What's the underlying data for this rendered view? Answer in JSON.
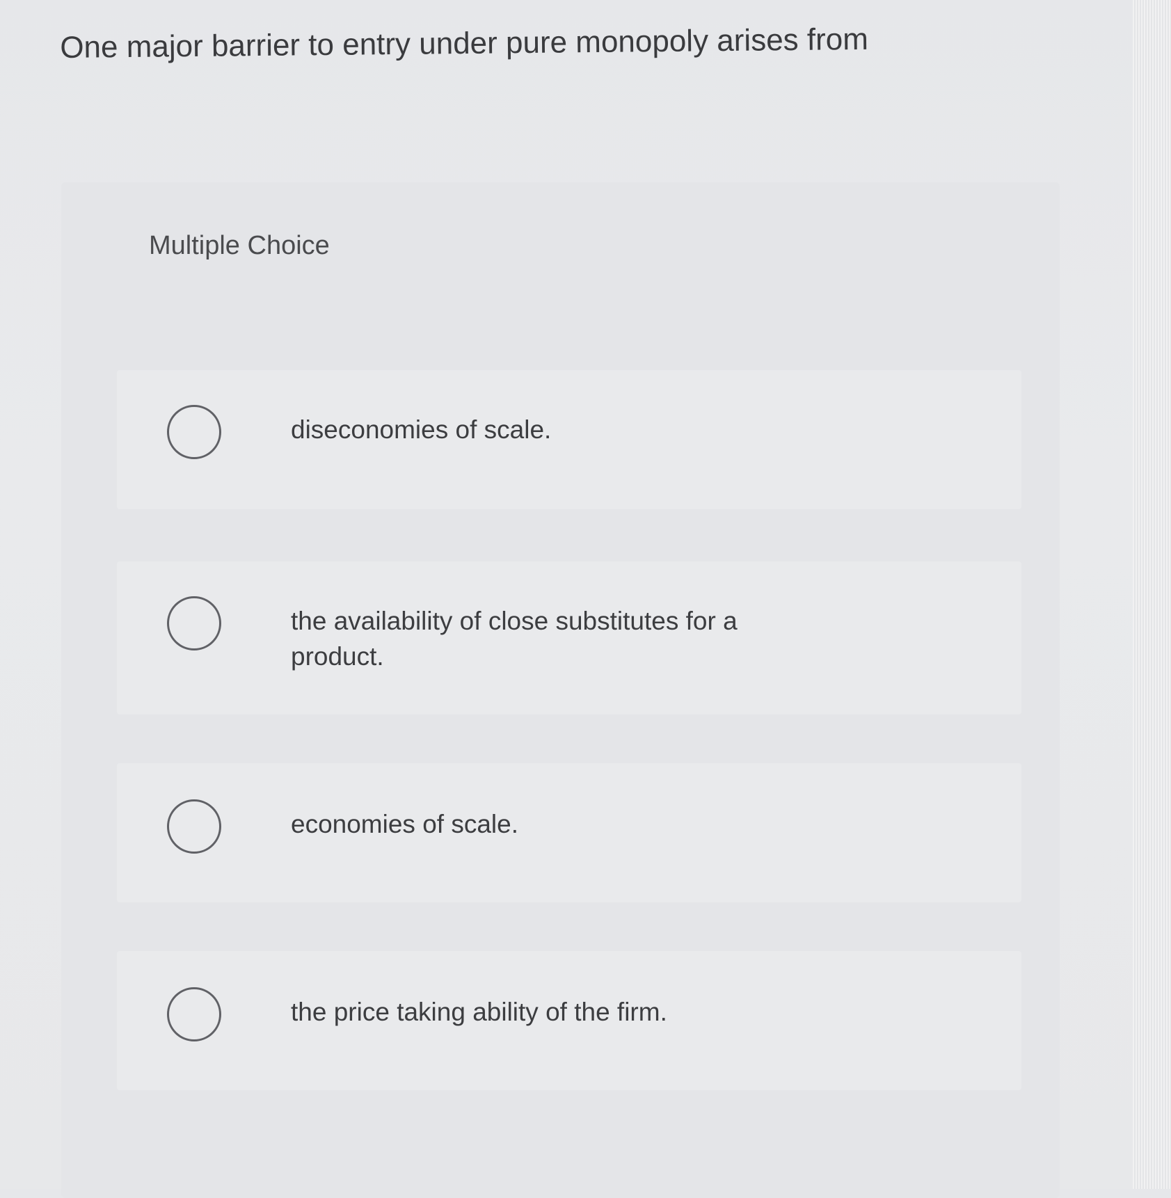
{
  "question": {
    "text": "One major barrier to entry under pure monopoly arises from"
  },
  "multiple_choice": {
    "label": "Multiple Choice",
    "options": [
      {
        "text": "diseconomies of scale."
      },
      {
        "text": "the availability of close substitutes for a product."
      },
      {
        "text": "economies of scale."
      },
      {
        "text": "the price taking ability of the firm."
      }
    ]
  }
}
